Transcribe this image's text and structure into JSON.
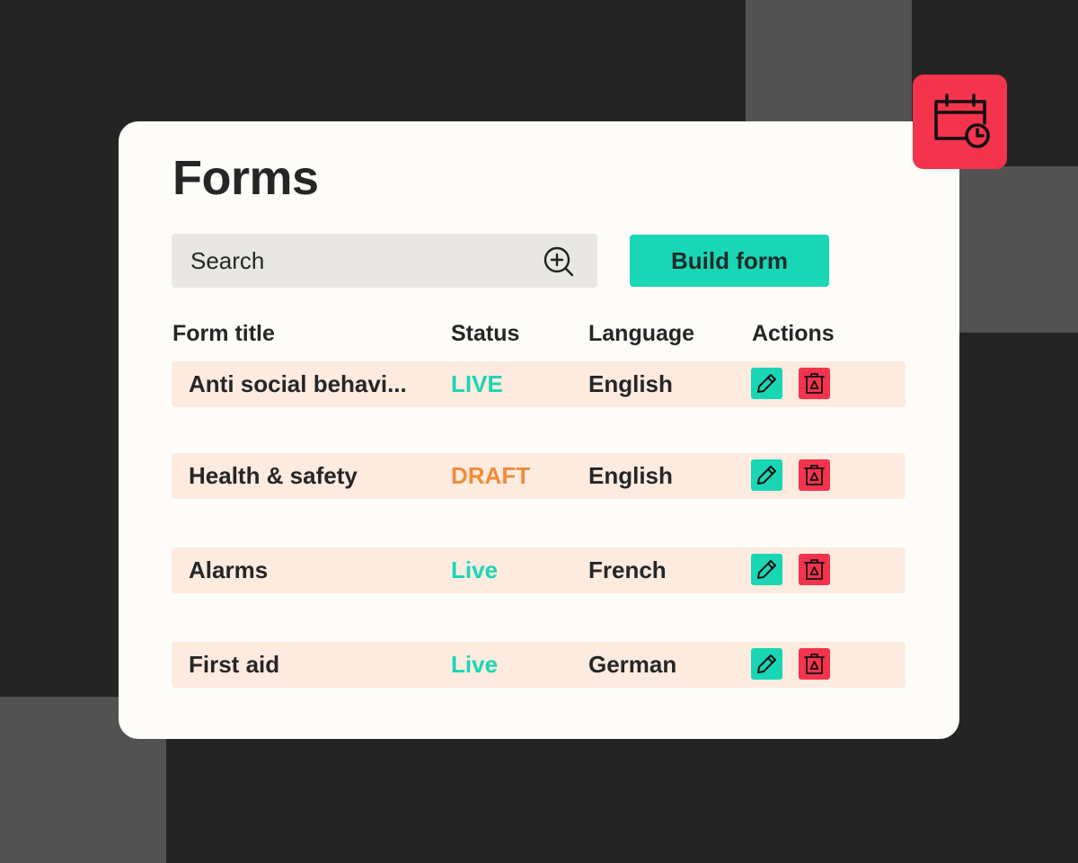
{
  "page": {
    "title": "Forms"
  },
  "search": {
    "placeholder": "Search",
    "icon": "zoom-in-icon"
  },
  "toolbar": {
    "build_label": "Build form"
  },
  "table": {
    "headers": [
      "Form title",
      "Status",
      "Language",
      "Actions"
    ],
    "rows": [
      {
        "title": "Anti social behavi...",
        "status": "LIVE",
        "status_color": "#19d6b5",
        "language": "English"
      },
      {
        "title": "Health & safety",
        "status": "DRAFT",
        "status_color": "#f28c38",
        "language": "English"
      },
      {
        "title": "Alarms",
        "status": "Live",
        "status_color": "#19d6b5",
        "language": "French"
      },
      {
        "title": "First aid",
        "status": "Live",
        "status_color": "#19d6b5",
        "language": "German"
      }
    ],
    "actions": {
      "edit_icon": "pencil-icon",
      "delete_icon": "trash-icon"
    }
  },
  "badge": {
    "icon": "calendar-clock-icon"
  },
  "colors": {
    "background": "#242424",
    "accent_teal": "#19d6b5",
    "accent_red": "#f4334d",
    "draft_orange": "#f28c38",
    "row_bg": "#fdebdf",
    "card_bg": "#fdfcf8"
  }
}
